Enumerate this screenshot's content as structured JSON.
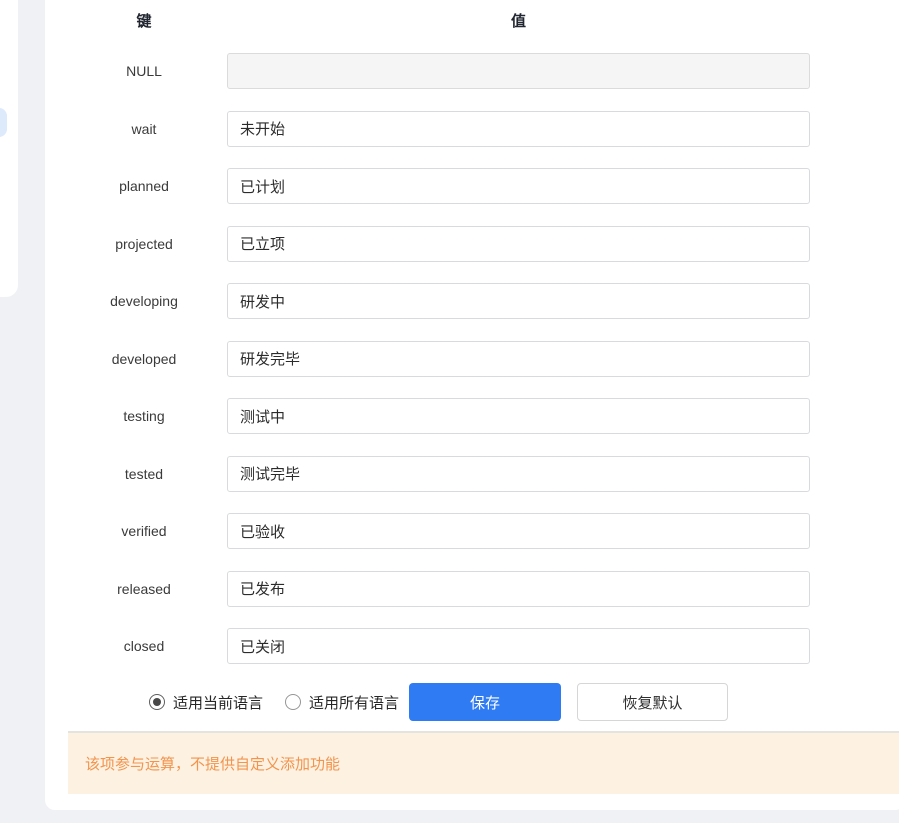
{
  "table": {
    "key_header": "键",
    "value_header": "值",
    "rows": [
      {
        "key": "NULL",
        "value": "",
        "disabled": true
      },
      {
        "key": "wait",
        "value": "未开始"
      },
      {
        "key": "planned",
        "value": "已计划"
      },
      {
        "key": "projected",
        "value": "已立项"
      },
      {
        "key": "developing",
        "value": "研发中"
      },
      {
        "key": "developed",
        "value": "研发完毕"
      },
      {
        "key": "testing",
        "value": "测试中"
      },
      {
        "key": "tested",
        "value": "测试完毕"
      },
      {
        "key": "verified",
        "value": "已验收"
      },
      {
        "key": "released",
        "value": "已发布"
      },
      {
        "key": "closed",
        "value": "已关闭"
      }
    ]
  },
  "options": {
    "current_language": {
      "label": "适用当前语言",
      "selected": true
    },
    "all_languages": {
      "label": "适用所有语言",
      "selected": false
    }
  },
  "actions": {
    "save_label": "保存",
    "restore_label": "恢复默认"
  },
  "notice": {
    "text": "该项参与运算，不提供自定义添加功能"
  },
  "colors": {
    "primary_blue": "#2e7bf3",
    "notice_text": "#f2944d",
    "notice_bg": "#fdf1e2",
    "active_pill": "#ddeafc",
    "page_bg": "#eff1f4"
  }
}
